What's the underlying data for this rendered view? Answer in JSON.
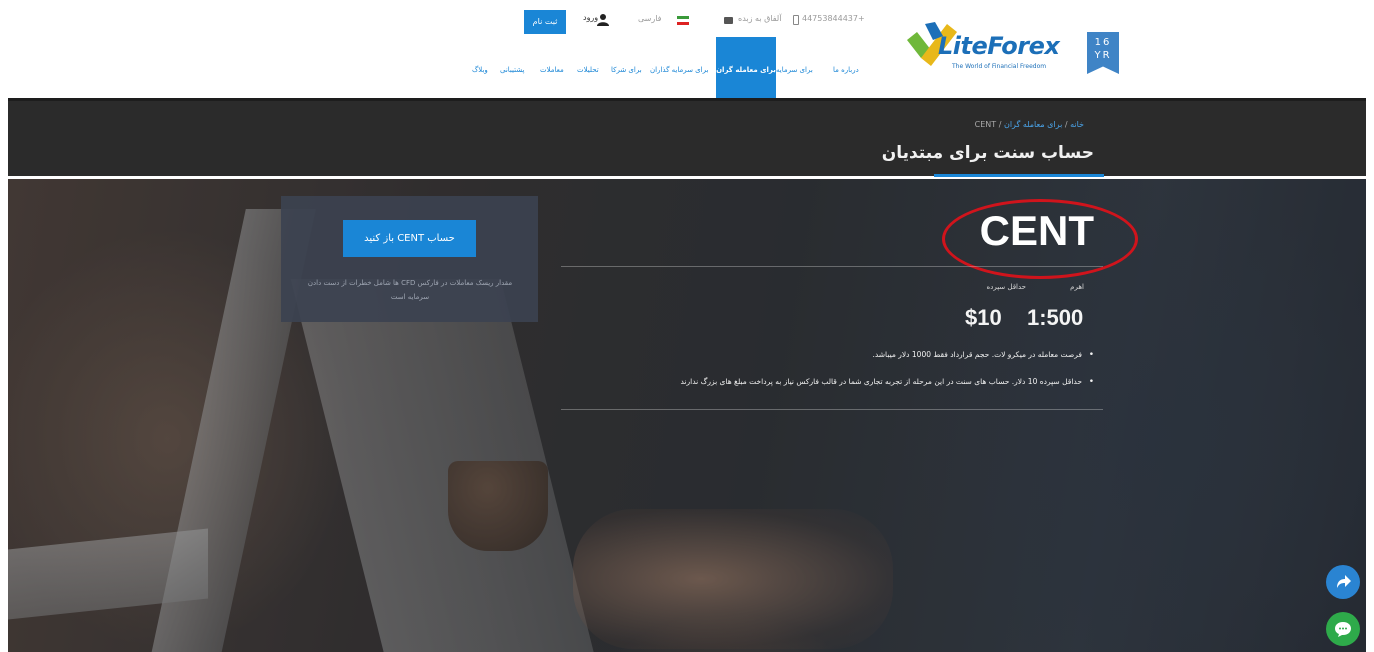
{
  "header": {
    "badge_text": "16 YR",
    "logo": {
      "brand": "LiteForex",
      "tagline": "The World of Financial Freedom",
      "colors": {
        "blue": "#1c6fb8",
        "green": "#6fb83a",
        "yellow": "#e8b81a"
      }
    },
    "phone": "44753844437+",
    "callback": "آلفاق به زبده",
    "language": "فارسی",
    "login": "ورود",
    "register": "ثبت نام",
    "nav": {
      "items": [
        {
          "label": "درباره ما"
        },
        {
          "label": "برای سرمایه"
        },
        {
          "label": "برای معامله گران"
        },
        {
          "label": "برای سرمایه گذاران"
        },
        {
          "label": "برای شرکا"
        },
        {
          "label": "تحلیلات"
        },
        {
          "label": "معاملات"
        },
        {
          "label": "پشتیبانی"
        },
        {
          "label": "وبلاگ"
        }
      ],
      "active_index": 2
    }
  },
  "band": {
    "breadcrumb": {
      "home": "خانه",
      "section": "برای معامله گران",
      "current": "CENT"
    },
    "title": "حساب سنت برای مبتدیان"
  },
  "hero": {
    "cta": {
      "button": "حساب CENT باز کنید",
      "note": "مقدار ریسک معاملات در فارکس CFD ها شامل خطرات از دست دادن سرمایه است"
    },
    "account_name": "CENT",
    "stats": {
      "leverage_label": "اهرم",
      "leverage_value": "1:500",
      "deposit_label": "حداقل سپرده",
      "deposit_value": "$10"
    },
    "features": [
      "فرصت معامله در میکرو لات. حجم قرارداد فقط 1000 دلار میباشد.",
      "حداقل سپرده 10 دلار. حساب های سنت در این مرحله از تجربه تجاری شما در قالب فارکس نیاز به پرداخت مبلغ های بزرگ ندارند"
    ],
    "highlight_color": "#d0141c"
  },
  "floating": {
    "share_icon": "share-arrow-icon",
    "chat_icon": "chat-bubble-icon",
    "share_color": "#2a84d2",
    "chat_color": "#2eaa4a"
  }
}
